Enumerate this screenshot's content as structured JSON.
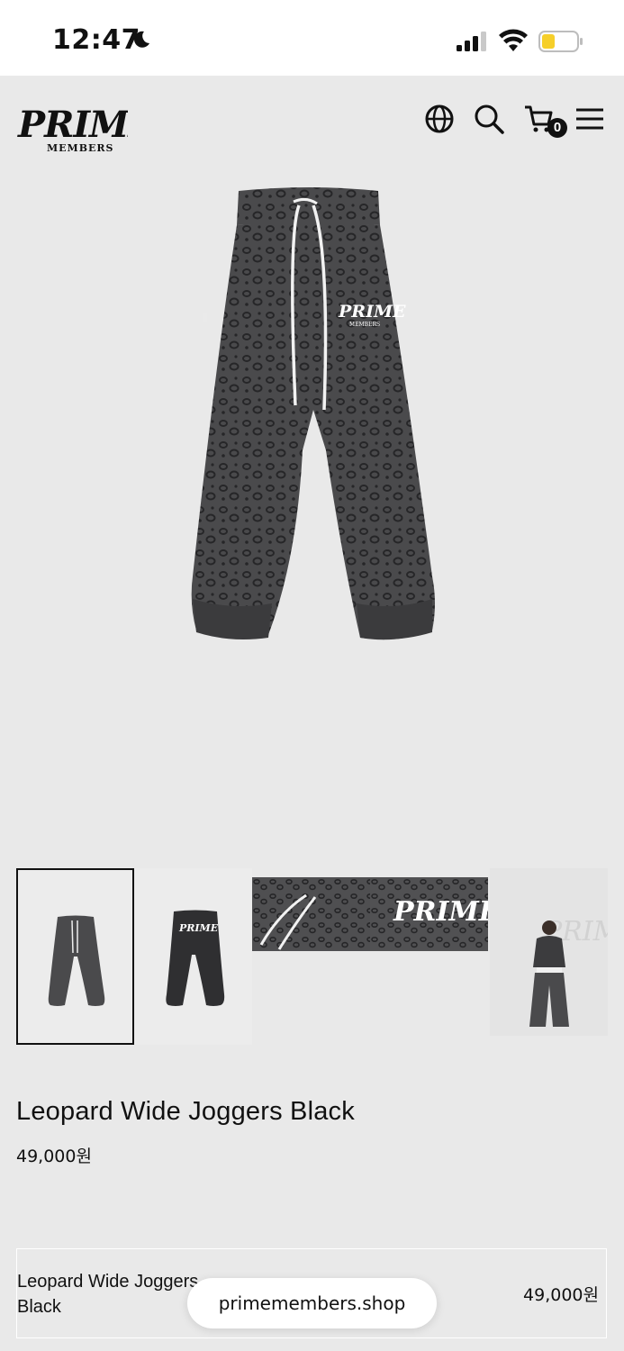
{
  "status_bar": {
    "time": "12:47",
    "battery_color": "#f6cf2a"
  },
  "header": {
    "brand_main": "PRIME",
    "brand_sub": "MEMBERS",
    "icons": [
      "globe-icon",
      "search-icon",
      "cart-icon",
      "hamburger-menu-icon"
    ],
    "cart_count": "0"
  },
  "product": {
    "title": "Leopard Wide Joggers Black",
    "price": "49,000원",
    "thumbnails": [
      "front view",
      "back view",
      "waistband detail",
      "logo detail",
      "model shot"
    ],
    "selected_thumbnail": 0
  },
  "option": {
    "name": "Leopard Wide Joggers Black",
    "price": "49,000원"
  },
  "browser": {
    "url": "primemembers.shop"
  }
}
